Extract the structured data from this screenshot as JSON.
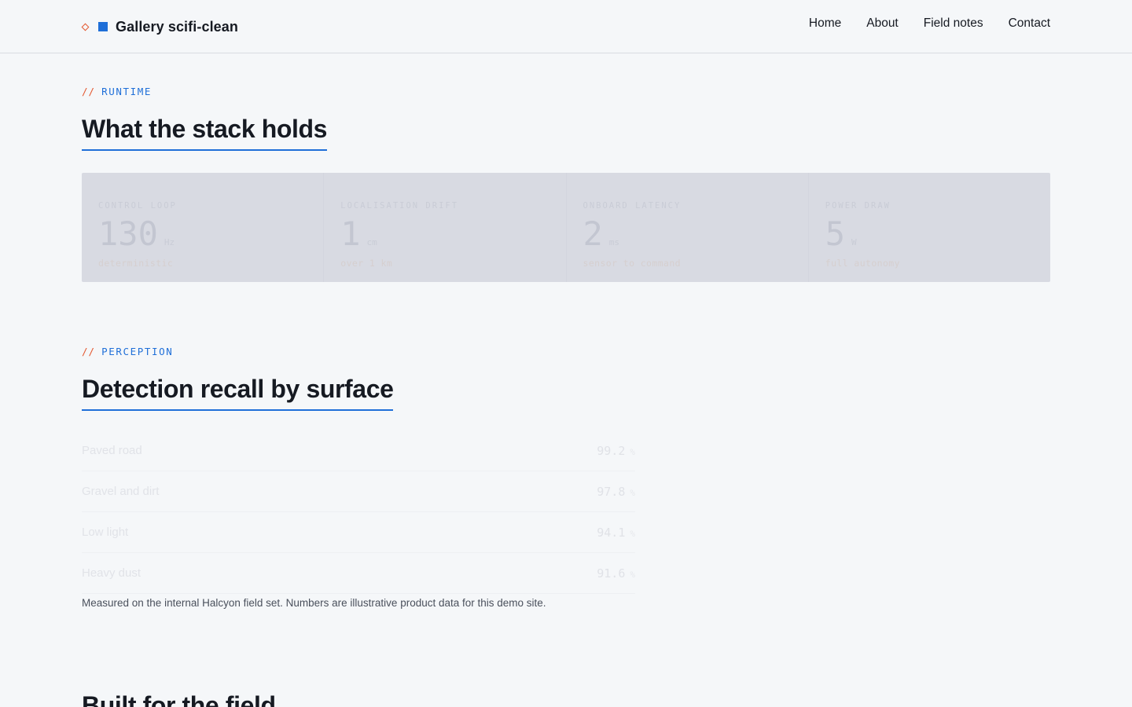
{
  "header": {
    "brand": "Gallery scifi-clean",
    "nav": [
      "Home",
      "About",
      "Field notes",
      "Contact"
    ]
  },
  "runtime": {
    "eyebrow_slash": "//",
    "eyebrow": "RUNTIME",
    "title": "What the stack holds",
    "stats": [
      {
        "label": "CONTROL LOOP",
        "value": "130",
        "unit": "Hz",
        "note": "deterministic"
      },
      {
        "label": "LOCALISATION DRIFT",
        "value": "1",
        "unit": "cm",
        "note": "over 1 km"
      },
      {
        "label": "ONBOARD LATENCY",
        "value": "2",
        "unit": "ms",
        "note": "sensor to command"
      },
      {
        "label": "POWER DRAW",
        "value": "5",
        "unit": "W",
        "note": "full autonomy"
      }
    ]
  },
  "perception": {
    "eyebrow_slash": "//",
    "eyebrow": "PERCEPTION",
    "title": "Detection recall by surface",
    "rows": [
      {
        "name": "Paved road",
        "value": "99.2",
        "unit": "%"
      },
      {
        "name": "Gravel and dirt",
        "value": "97.8",
        "unit": "%"
      },
      {
        "name": "Low light",
        "value": "94.1",
        "unit": "%"
      },
      {
        "name": "Heavy dust",
        "value": "91.6",
        "unit": "%"
      }
    ],
    "footnote": "Measured on the internal Halcyon field set. Numbers are illustrative product data for this demo site."
  },
  "next_section": {
    "title": "Built for the field"
  }
}
